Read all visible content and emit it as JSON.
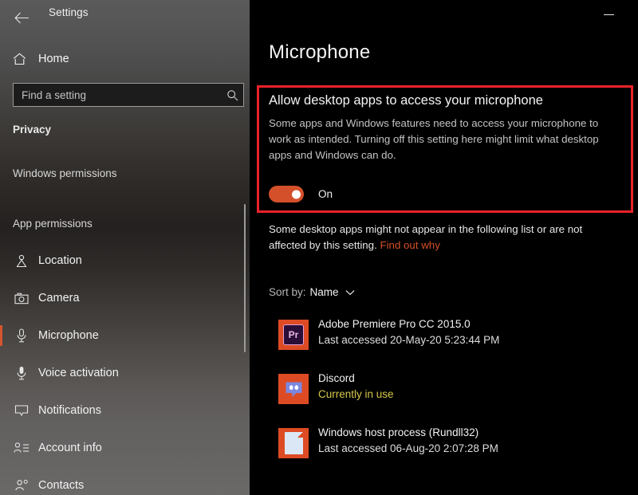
{
  "titlebar": {
    "back_label": "back-arrow",
    "app_title": "Settings",
    "minimize_label": "minimize"
  },
  "sidebar": {
    "home": {
      "label": "Home",
      "icon": "home-icon"
    },
    "search": {
      "placeholder": "Find a setting",
      "value": "",
      "icon": "search-icon"
    },
    "section_title": "Privacy",
    "groups": [
      {
        "label": "Windows permissions"
      },
      {
        "label": "App permissions"
      }
    ],
    "items": [
      {
        "label": "Location",
        "icon": "location-icon",
        "selected": false
      },
      {
        "label": "Camera",
        "icon": "camera-icon",
        "selected": false
      },
      {
        "label": "Microphone",
        "icon": "microphone-icon",
        "selected": true
      },
      {
        "label": "Voice activation",
        "icon": "voice-icon",
        "selected": false
      },
      {
        "label": "Notifications",
        "icon": "bell-icon",
        "selected": false
      },
      {
        "label": "Account info",
        "icon": "account-icon",
        "selected": false
      },
      {
        "label": "Contacts",
        "icon": "contacts-icon",
        "selected": false
      }
    ],
    "accent_color": "#d4552e"
  },
  "main": {
    "page_title": "Microphone",
    "highlight": {
      "border_color": "#e8222a",
      "heading": "Allow desktop apps to access your microphone",
      "description": "Some apps and Windows features need to access your microphone to work as intended. Turning off this setting here might limit what desktop apps and Windows can do.",
      "toggle": {
        "state": "On",
        "on_color": "#d4502a"
      }
    },
    "note": {
      "text": "Some desktop apps might not appear in the following list or are not affected by this setting. ",
      "link_text": "Find out why",
      "link_color": "#d4502a"
    },
    "sort": {
      "label": "Sort by:",
      "value": "Name",
      "icon": "chevron-down-icon"
    },
    "apps": [
      {
        "name": "Adobe Premiere Pro CC 2015.0",
        "status": "Last accessed 20-May-20 5:23:44 PM",
        "in_use": false,
        "icon": "premiere-pro-icon"
      },
      {
        "name": "Discord",
        "status": "Currently in use",
        "in_use": true,
        "icon": "discord-icon"
      },
      {
        "name": "Windows host process (Rundll32)",
        "status": "Last accessed 06-Aug-20 2:07:28 PM",
        "in_use": false,
        "icon": "document-icon"
      }
    ],
    "in_use_color": "#d6c74a"
  }
}
